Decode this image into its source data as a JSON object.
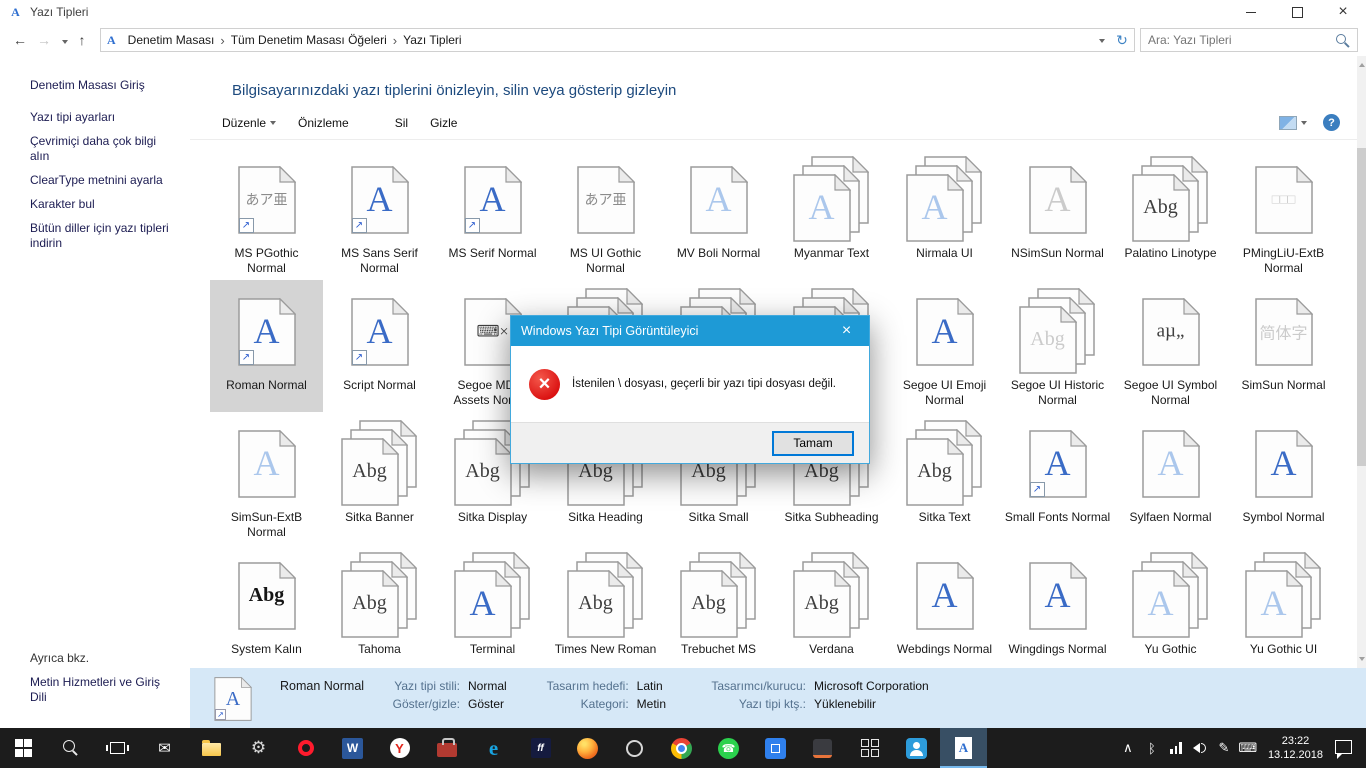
{
  "window": {
    "title": "Yazı Tipleri",
    "icon_glyph": "A",
    "breadcrumb": [
      "Denetim Masası",
      "Tüm Denetim Masası Öğeleri",
      "Yazı Tipleri"
    ],
    "search_placeholder": "Ara: Yazı Tipleri"
  },
  "sidebar": {
    "home": "Denetim Masası Giriş",
    "tasks": [
      "Yazı tipi ayarları",
      "Çevrimiçi daha çok bilgi alın",
      "ClearType metnini ayarla",
      "Karakter bul",
      "Bütün diller için yazı tipleri indirin"
    ],
    "see_also_heading": "Ayrıca bkz.",
    "see_also": [
      "Metin Hizmetleri ve Giriş Dili"
    ]
  },
  "main": {
    "heading": "Bilgisayarınızdaki yazı tiplerini önizleyin, silin veya gösterip gizleyin",
    "commands": {
      "organize": "Düzenle",
      "preview": "Önizleme",
      "delete": "Sil",
      "hide": "Gizle"
    }
  },
  "fonts": [
    {
      "name": "MS PGothic Normal",
      "glyph": "あア亜",
      "color": "cjk",
      "shortcut": true
    },
    {
      "name": "MS Sans Serif Normal",
      "glyph": "A",
      "color": "blue",
      "shortcut": true
    },
    {
      "name": "MS Serif Normal",
      "glyph": "A",
      "color": "blue",
      "shortcut": true
    },
    {
      "name": "MS UI Gothic Normal",
      "glyph": "あア亜",
      "color": "cjk"
    },
    {
      "name": "MV Boli Normal",
      "glyph": "A",
      "color": "lightblue"
    },
    {
      "name": "Myanmar Text",
      "glyph": "A",
      "color": "lightblue",
      "stacked": true
    },
    {
      "name": "Nirmala UI",
      "glyph": "A",
      "color": "lightblue",
      "stacked": true
    },
    {
      "name": "NSimSun Normal",
      "glyph": "A",
      "color": "faint"
    },
    {
      "name": "Palatino Linotype",
      "glyph": "Abg",
      "color": "dark",
      "stacked": true
    },
    {
      "name": "PMingLiU-ExtB Normal",
      "glyph": "□□□",
      "color": "faint"
    },
    {
      "name": "Roman Normal",
      "glyph": "A",
      "color": "blue",
      "shortcut": true,
      "selected": true
    },
    {
      "name": "Script Normal",
      "glyph": "A",
      "color": "blue",
      "shortcut": true
    },
    {
      "name": "Segoe MDL2 Assets Normal",
      "glyph": "⌨×",
      "color": "dark"
    },
    {
      "name": "",
      "glyph": "",
      "color": "dark",
      "stacked": true,
      "covered": true
    },
    {
      "name": "",
      "glyph": "",
      "color": "dark",
      "stacked": true,
      "covered": true
    },
    {
      "name": "",
      "glyph": "",
      "color": "dark",
      "stacked": true,
      "covered": true
    },
    {
      "name": "Segoe UI Emoji Normal",
      "glyph": "A",
      "color": "blue"
    },
    {
      "name": "Segoe UI Historic Normal",
      "glyph": "Abg",
      "color": "faint",
      "stacked": true
    },
    {
      "name": "Segoe UI Symbol Normal",
      "glyph": "aµ„",
      "color": "dark"
    },
    {
      "name": "SimSun Normal",
      "glyph": "简体字",
      "color": "faint"
    },
    {
      "name": "SimSun-ExtB Normal",
      "glyph": "A",
      "color": "lightblue"
    },
    {
      "name": "Sitka Banner",
      "glyph": "Abg",
      "color": "dark",
      "stacked": true
    },
    {
      "name": "Sitka Display",
      "glyph": "Abg",
      "color": "dark",
      "stacked": true
    },
    {
      "name": "Sitka Heading",
      "glyph": "Abg",
      "color": "dark",
      "stacked": true
    },
    {
      "name": "Sitka Small",
      "glyph": "Abg",
      "color": "dark",
      "stacked": true
    },
    {
      "name": "Sitka Subheading",
      "glyph": "Abg",
      "color": "dark",
      "stacked": true
    },
    {
      "name": "Sitka Text",
      "glyph": "Abg",
      "color": "dark",
      "stacked": true
    },
    {
      "name": "Small Fonts Normal",
      "glyph": "A",
      "color": "blue",
      "shortcut": true
    },
    {
      "name": "Sylfaen Normal",
      "glyph": "A",
      "color": "lightblue"
    },
    {
      "name": "Symbol Normal",
      "glyph": "A",
      "color": "blue"
    },
    {
      "name": "System Kalın",
      "glyph": "Abg",
      "color": "black"
    },
    {
      "name": "Tahoma",
      "glyph": "Abg",
      "color": "dark",
      "stacked": true
    },
    {
      "name": "Terminal",
      "glyph": "A",
      "color": "blue",
      "stacked": true
    },
    {
      "name": "Times New Roman",
      "glyph": "Abg",
      "color": "dark",
      "stacked": true
    },
    {
      "name": "Trebuchet MS",
      "glyph": "Abg",
      "color": "dark",
      "stacked": true
    },
    {
      "name": "Verdana",
      "glyph": "Abg",
      "color": "dark",
      "stacked": true
    },
    {
      "name": "Webdings Normal",
      "glyph": "A",
      "color": "blue"
    },
    {
      "name": "Wingdings Normal",
      "glyph": "A",
      "color": "blue"
    },
    {
      "name": "Yu Gothic",
      "glyph": "A",
      "color": "lightblue",
      "stacked": true
    },
    {
      "name": "Yu Gothic UI",
      "glyph": "A",
      "color": "lightblue",
      "stacked": true
    }
  ],
  "dialog": {
    "title": "Windows Yazı Tipi Görüntüleyici",
    "message": "İstenilen \\ dosyası, geçerli bir yazı tipi dosyası değil.",
    "ok": "Tamam"
  },
  "details": {
    "name": "Roman Normal",
    "icon_glyph": "A",
    "col1": [
      {
        "label": "Yazı tipi stili:",
        "value": "Normal"
      },
      {
        "label": "Göster/gizle:",
        "value": "Göster"
      }
    ],
    "col2": [
      {
        "label": "Tasarım hedefi:",
        "value": "Latin"
      },
      {
        "label": "Kategori:",
        "value": "Metin"
      }
    ],
    "col3": [
      {
        "label": "Tasarımcı/kurucu:",
        "value": "Microsoft Corporation"
      },
      {
        "label": "Yazı tipi ktş.:",
        "value": "Yüklenebilir"
      }
    ]
  },
  "taskbar": {
    "time": "23:22",
    "date": "13.12.2018",
    "apps": [
      {
        "name": "start-button",
        "type": "start"
      },
      {
        "name": "search-button",
        "type": "search"
      },
      {
        "name": "task-view-button",
        "type": "taskview"
      },
      {
        "name": "mail-icon",
        "type": "glyph",
        "glyph": "✉",
        "style": "mail"
      },
      {
        "name": "file-explorer-icon",
        "type": "folder"
      },
      {
        "name": "settings-icon",
        "type": "glyph",
        "glyph": "⚙",
        "style": "settings"
      },
      {
        "name": "opera-icon",
        "type": "shape",
        "style": "opera"
      },
      {
        "name": "word-icon",
        "type": "glyph",
        "glyph": "W",
        "style": "word"
      },
      {
        "name": "yandex-icon",
        "type": "glyph",
        "glyph": "Y",
        "style": "yandex"
      },
      {
        "name": "toolbox-icon",
        "type": "shape",
        "style": "toolbox"
      },
      {
        "name": "edge-icon",
        "type": "glyph",
        "glyph": "e",
        "style": "edge"
      },
      {
        "name": "ff-app-icon",
        "type": "glyph",
        "glyph": "ff",
        "style": "ffapp"
      },
      {
        "name": "firefox-icon",
        "type": "shape",
        "style": "firefox"
      },
      {
        "name": "ring-app-icon",
        "type": "shape",
        "style": "ring"
      },
      {
        "name": "chrome-icon",
        "type": "shape",
        "style": "chrome"
      },
      {
        "name": "whatsapp-icon",
        "type": "glyph",
        "glyph": "☎",
        "style": "whatsapp"
      },
      {
        "name": "blue-app-icon",
        "type": "shape",
        "style": "blueapp"
      },
      {
        "name": "dark-app-icon",
        "type": "shape",
        "style": "darkapp"
      },
      {
        "name": "grid-app-icon",
        "type": "shape",
        "style": "gridapp"
      },
      {
        "name": "people-app-icon",
        "type": "shape",
        "style": "people"
      },
      {
        "name": "font-viewer-taskbar-icon",
        "type": "fontviewer",
        "active": true
      }
    ],
    "tray": [
      {
        "name": "tray-expand-icon",
        "glyph": "∧"
      },
      {
        "name": "bluetooth-icon",
        "glyph": "ᛒ"
      },
      {
        "name": "network-icon",
        "type": "bars"
      },
      {
        "name": "volume-icon",
        "type": "volume"
      },
      {
        "name": "pen-icon",
        "glyph": "✎"
      },
      {
        "name": "keyboard-icon",
        "glyph": "⌨"
      }
    ]
  },
  "colors": {
    "accent": "#1e9ad6",
    "error": "#da1010",
    "selection": "#d4d4d4",
    "details_bg": "#d6e8f7"
  }
}
